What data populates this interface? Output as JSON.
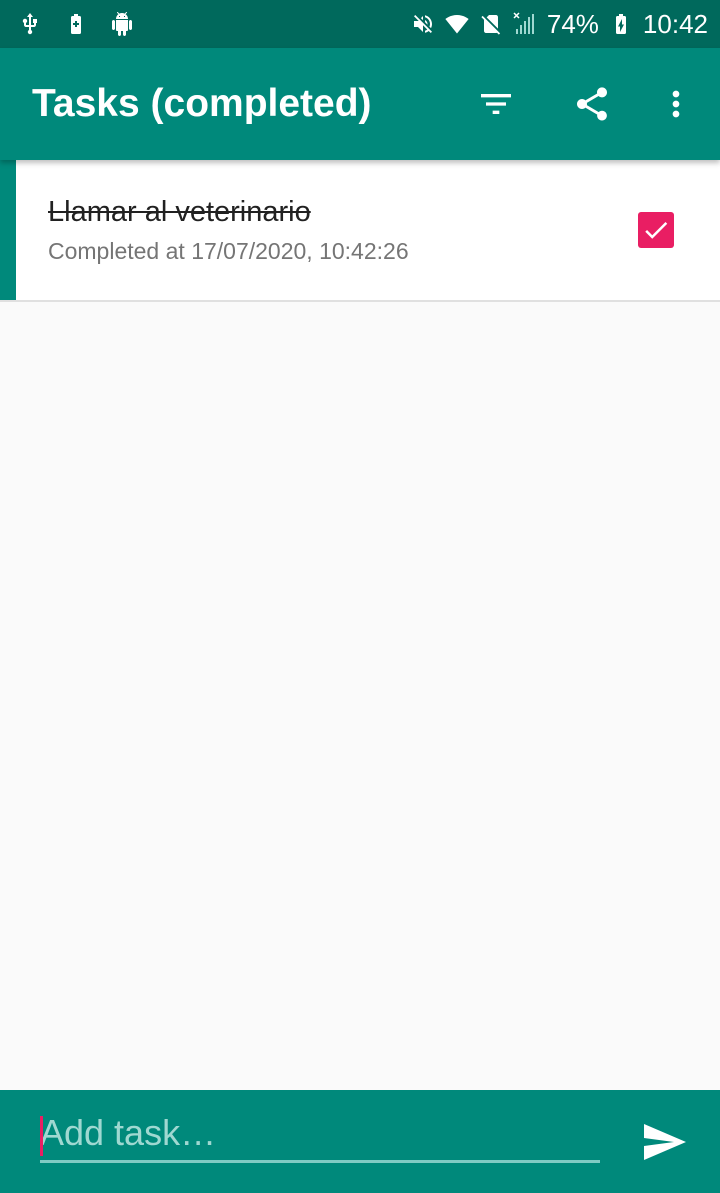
{
  "status_bar": {
    "battery_percent": "74%",
    "time": "10:42",
    "left_icons": [
      "usb-icon",
      "battery-saver-icon",
      "android-debug-icon"
    ],
    "right_icons": [
      "mute-icon",
      "wifi-icon",
      "no-sim-icon",
      "signal-icon",
      "battery-charging-icon"
    ]
  },
  "app_bar": {
    "title": "Tasks (completed)",
    "actions": [
      "filter-icon",
      "share-icon",
      "more-vert-icon"
    ],
    "color": "#00897b"
  },
  "tasks": [
    {
      "title": "Llamar al veterinario",
      "subtitle": "Completed at 17/07/2020, 10:42:26",
      "completed": true
    }
  ],
  "input_bar": {
    "placeholder": "Add task…",
    "value": "",
    "send_icon": "send-icon"
  },
  "colors": {
    "status_bar": "#00695c",
    "primary": "#00897b",
    "accent": "#e91e63",
    "background": "#fafafa"
  }
}
